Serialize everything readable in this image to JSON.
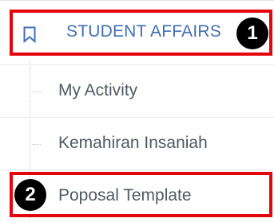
{
  "menu": {
    "section": {
      "label": "STUDENT AFFAIRS",
      "icon": "bookmark-icon"
    },
    "items": [
      {
        "label": "My Activity"
      },
      {
        "label": "Kemahiran Insaniah"
      },
      {
        "label": "Poposal Template"
      }
    ]
  },
  "annotations": [
    {
      "number": "1"
    },
    {
      "number": "2"
    }
  ],
  "colors": {
    "header_text": "#3f6fb4",
    "item_text": "#505a63",
    "callout_border": "#e3060c",
    "badge_bg": "#000000",
    "badge_text": "#ffffff"
  }
}
